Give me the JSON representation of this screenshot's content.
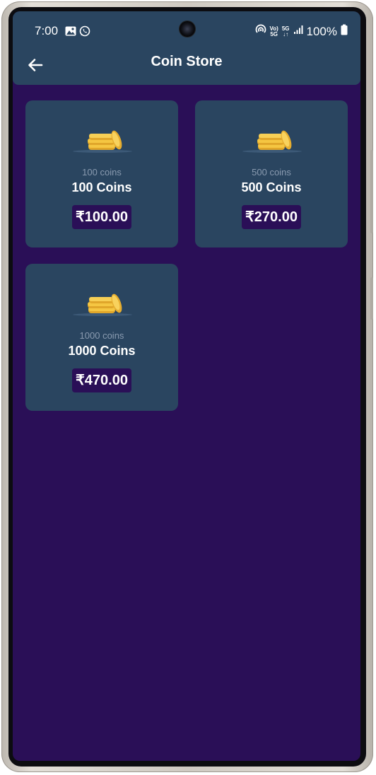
{
  "status": {
    "time": "7:00",
    "battery": "100%",
    "volte_label_top": "Vo)",
    "volte_label_bottom": "5G",
    "network_label_top": "5G",
    "network_label_bottom": "↓↑"
  },
  "header": {
    "title": "Coin Store",
    "back_icon": "arrow-left-icon"
  },
  "colors": {
    "background": "#2a0f57",
    "appbar": "#2a4560",
    "card": "#2a4560",
    "price_badge": "#2a0f57",
    "coin_gold": "#f2bf3a"
  },
  "packages": [
    {
      "subtitle": "100 coins",
      "title": "100 Coins",
      "price": "₹100.00",
      "icon": "coin-stack-icon"
    },
    {
      "subtitle": "500 coins",
      "title": "500 Coins",
      "price": "₹270.00",
      "icon": "coin-stack-icon"
    },
    {
      "subtitle": "1000 coins",
      "title": "1000 Coins",
      "price": "₹470.00",
      "icon": "coin-stack-icon"
    }
  ]
}
